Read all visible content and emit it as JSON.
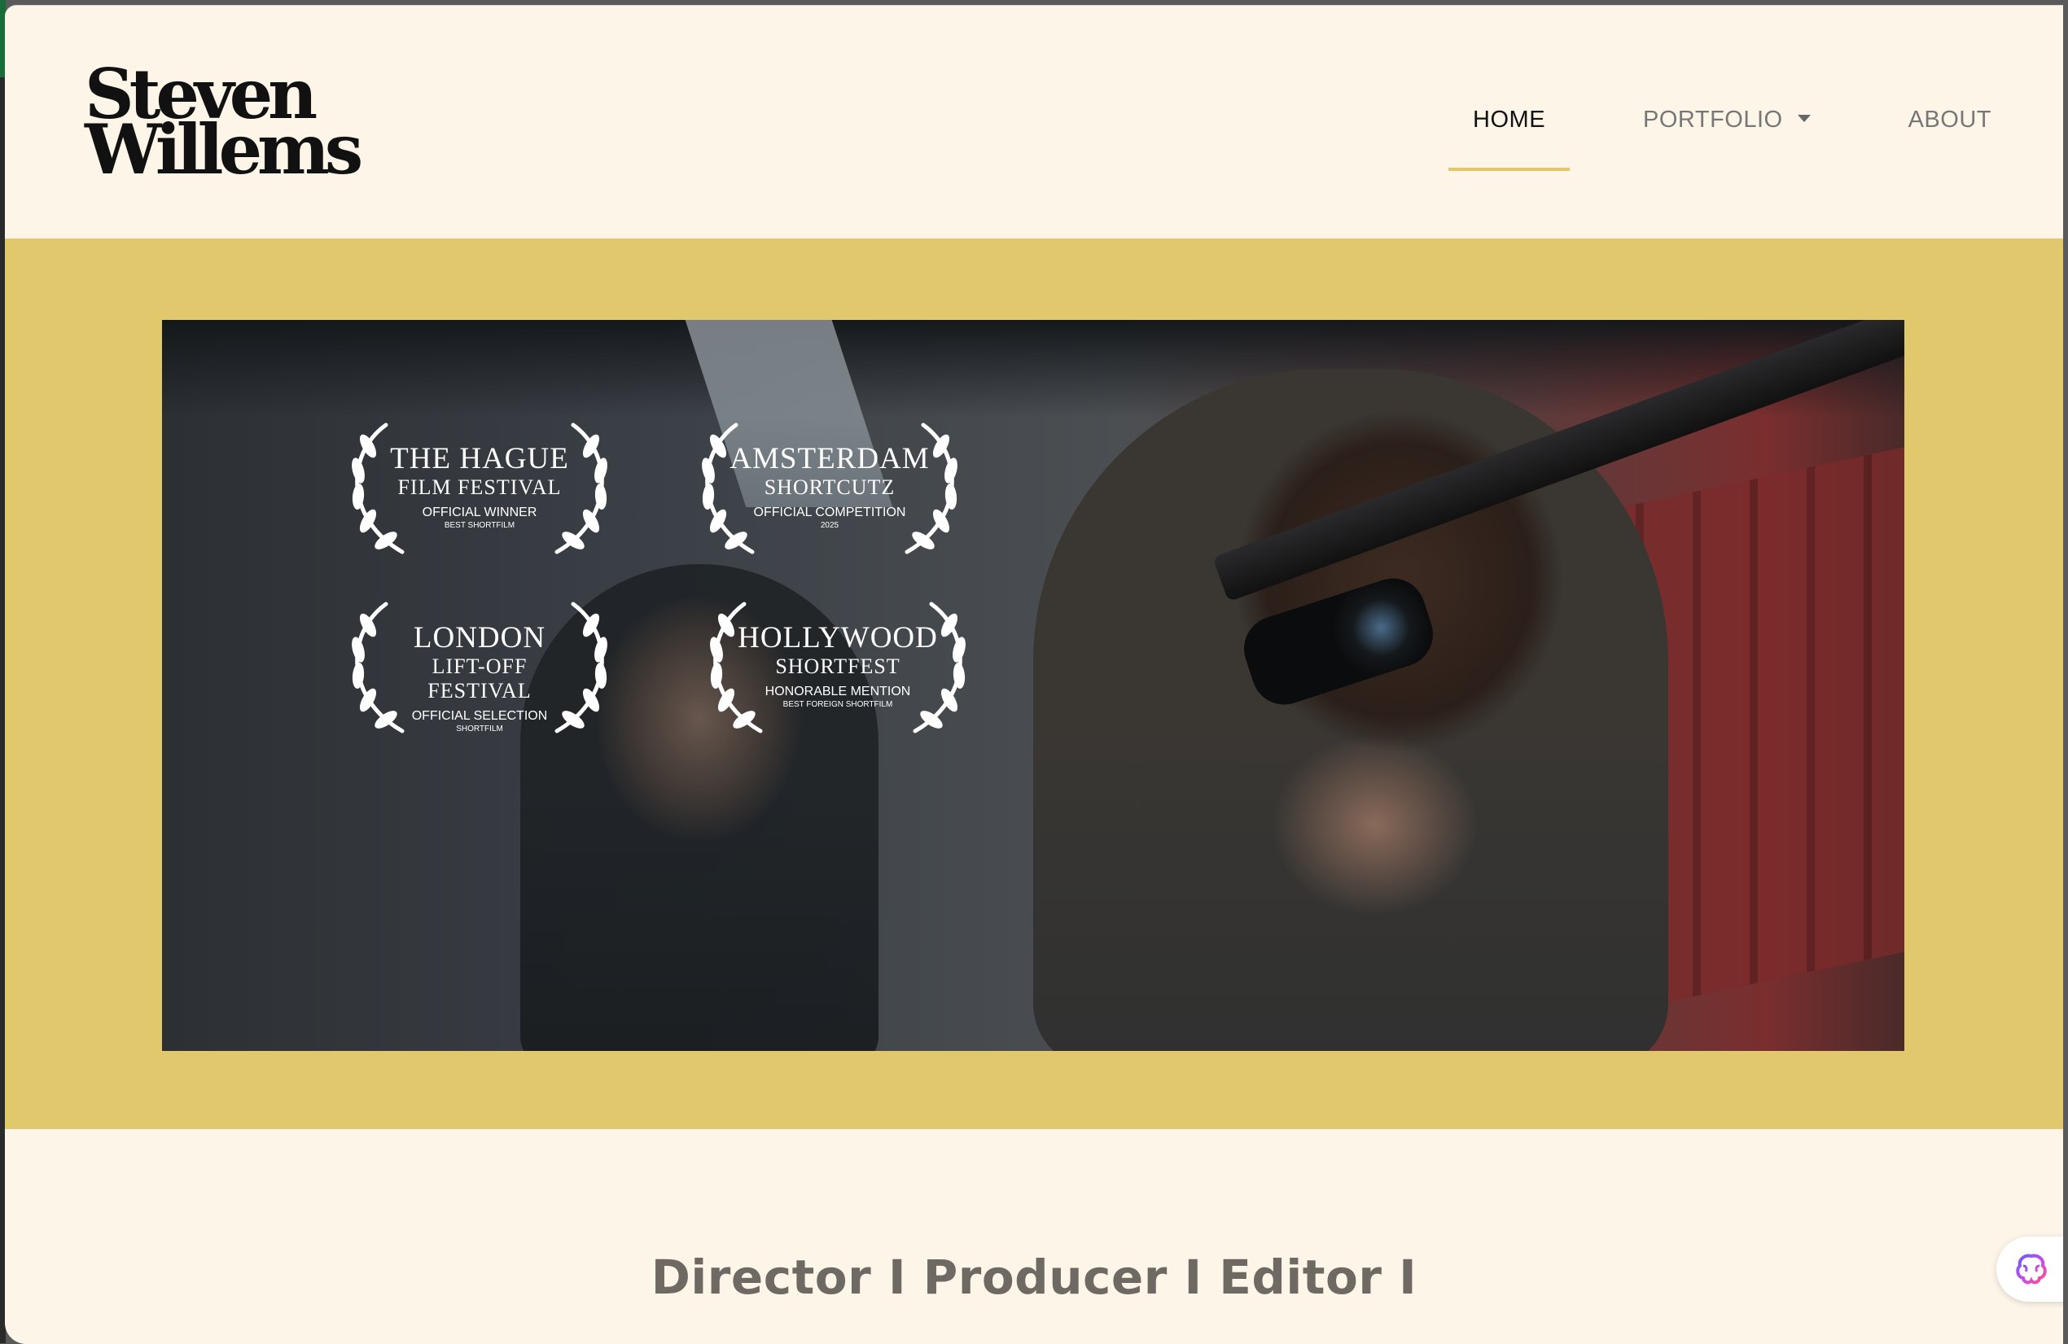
{
  "site": {
    "logo_line1": "Steven",
    "logo_line2": "Willems"
  },
  "nav": {
    "items": [
      {
        "label": "HOME",
        "active": true
      },
      {
        "label": "PORTFOLIO",
        "has_dropdown": true
      },
      {
        "label": "ABOUT"
      }
    ]
  },
  "hero": {
    "laurels": [
      {
        "title": "THE HAGUE",
        "subtitle": "FILM FESTIVAL",
        "note": "OFFICIAL WINNER",
        "small": "BEST SHORTFILM"
      },
      {
        "title": "AMSTERDAM",
        "subtitle": "SHORTCUTZ",
        "note": "OFFICIAL COMPETITION",
        "small": "2025"
      },
      {
        "title": "LONDON",
        "subtitle": "LIFT-OFF FESTIVAL",
        "note": "OFFICIAL SELECTION",
        "small": "SHORTFILM"
      },
      {
        "title": "HOLLYWOOD",
        "subtitle": "SHORTFEST",
        "note": "HONORABLE MENTION",
        "small": "BEST FOREIGN SHORTFILM"
      }
    ]
  },
  "tagline": "Director I Producer I Editor I",
  "colors": {
    "page_bg": "#fdf5e8",
    "hero_band": "#e2c86c",
    "nav_active_underline": "#e2c76a",
    "tagline": "#6e6a63"
  },
  "icons": {
    "assistant": "brain-icon",
    "dropdown": "caret-down-icon",
    "award": "laurel-wreath-icon"
  }
}
